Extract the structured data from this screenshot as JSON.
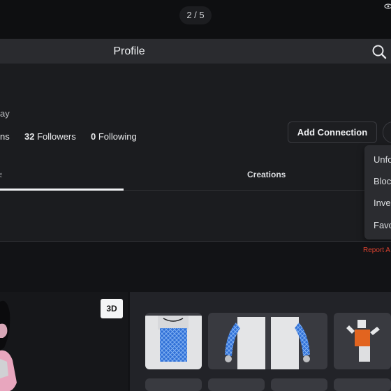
{
  "pager": "2 / 5",
  "header": {
    "title": "Profile"
  },
  "profile": {
    "subtitle_partial": "ay",
    "stats": [
      {
        "label_partial": "ns"
      },
      {
        "count": "32",
        "label": "Followers"
      },
      {
        "count": "0",
        "label": "Following"
      }
    ],
    "add_connection": "Add Connection"
  },
  "tabs": {
    "active_partial": "s",
    "second": "Creations"
  },
  "menu": {
    "items": [
      "Unfo",
      "Bloc",
      "Inve",
      "Favo"
    ]
  },
  "report": "Report A",
  "avatar": {
    "view_3d": "3D"
  },
  "colors": {
    "accent_blue": "#3d7be0",
    "report_red": "#d9412f",
    "item_orange": "#e2641f"
  },
  "icons": [
    "eye-icon",
    "search-icon",
    "more-icon"
  ]
}
